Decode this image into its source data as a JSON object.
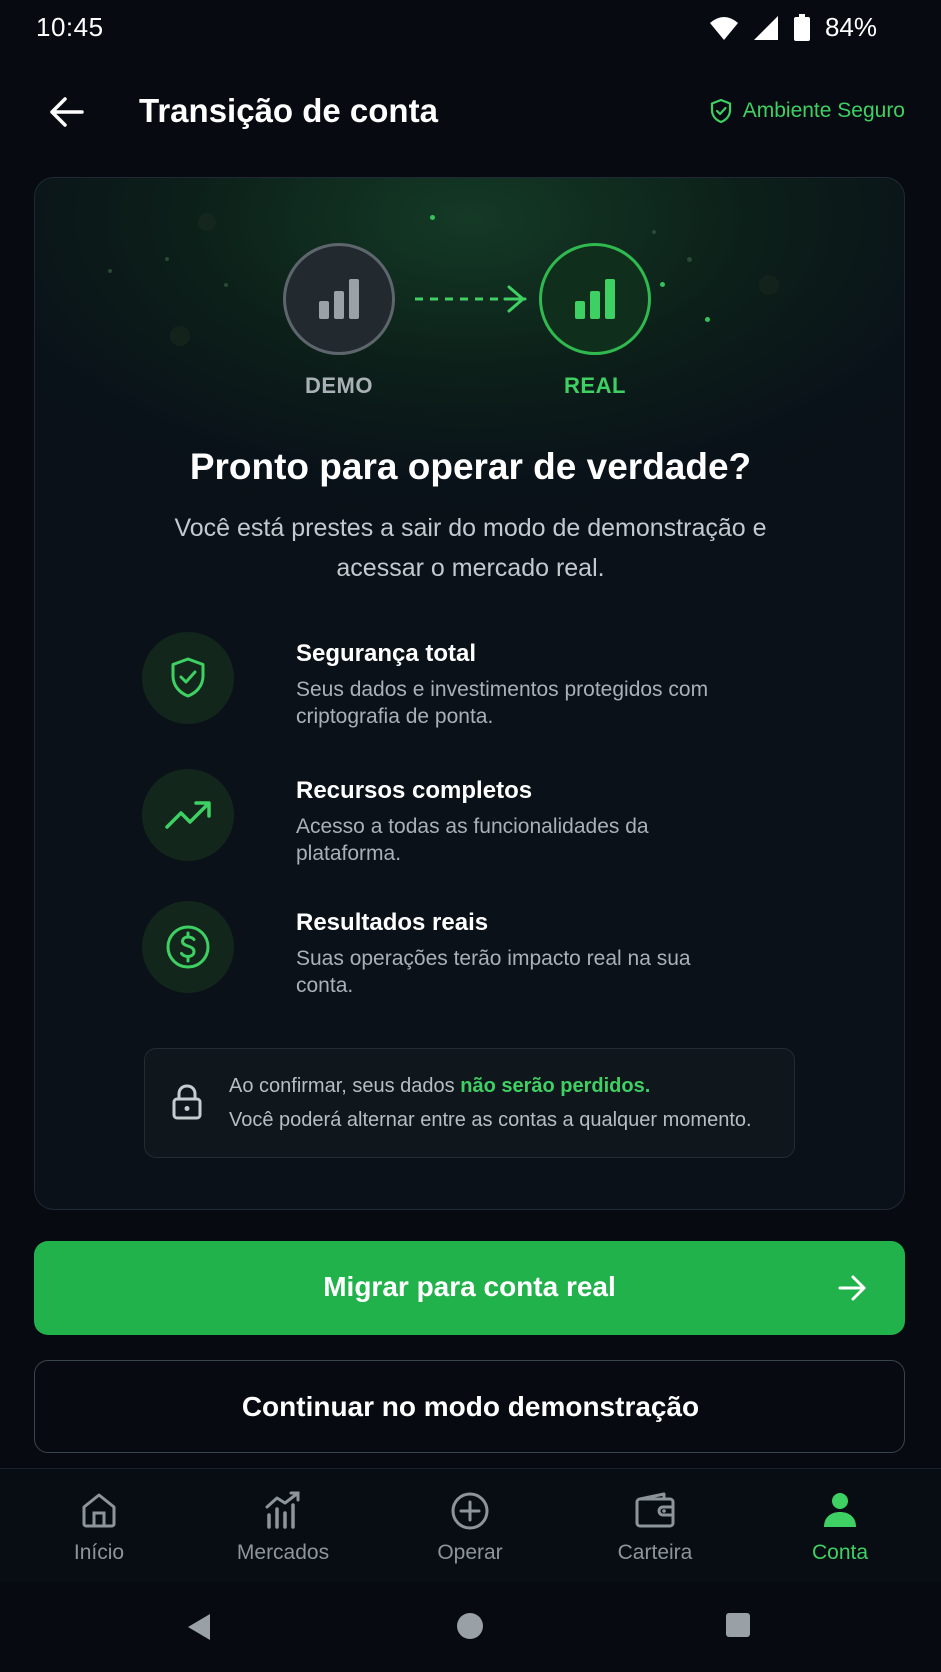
{
  "status_bar": {
    "time": "10:45",
    "battery": "84%"
  },
  "header": {
    "title": "Transição de conta",
    "secure_badge": "Ambiente Seguro"
  },
  "transition": {
    "from_label": "DEMO",
    "to_label": "REAL"
  },
  "headline": "Pronto para operar de verdade?",
  "subtext": "Você está prestes a sair do modo de demonstração e acessar o mercado real.",
  "features": [
    {
      "icon": "shield-check-icon",
      "title": "Segurança total",
      "desc": "Seus dados e investimentos protegidos com criptografia de ponta."
    },
    {
      "icon": "trending-up-icon",
      "title": "Recursos completos",
      "desc": "Acesso a todas as funcionalidades da plataforma."
    },
    {
      "icon": "dollar-circle-icon",
      "title": "Resultados reais",
      "desc": "Suas operações terão impacto real na sua conta."
    }
  ],
  "info": {
    "line1_prefix": "Ao confirmar, seus dados ",
    "line1_highlight": "não serão perdidos.",
    "line2": "Você poderá alternar entre as contas a qualquer momento."
  },
  "actions": {
    "primary": "Migrar para conta real",
    "secondary": "Continuar no modo demonstração"
  },
  "bottom_nav": [
    {
      "label": "Início",
      "icon": "home-icon",
      "active": false
    },
    {
      "label": "Mercados",
      "icon": "markets-chart-icon",
      "active": false
    },
    {
      "label": "Operar",
      "icon": "plus-circle-icon",
      "active": false
    },
    {
      "label": "Carteira",
      "icon": "wallet-icon",
      "active": false
    },
    {
      "label": "Conta",
      "icon": "user-icon",
      "active": true
    }
  ],
  "colors": {
    "accent": "#22b24c",
    "accent_text": "#3ed062",
    "background": "#070b11",
    "muted": "#8d959b"
  }
}
